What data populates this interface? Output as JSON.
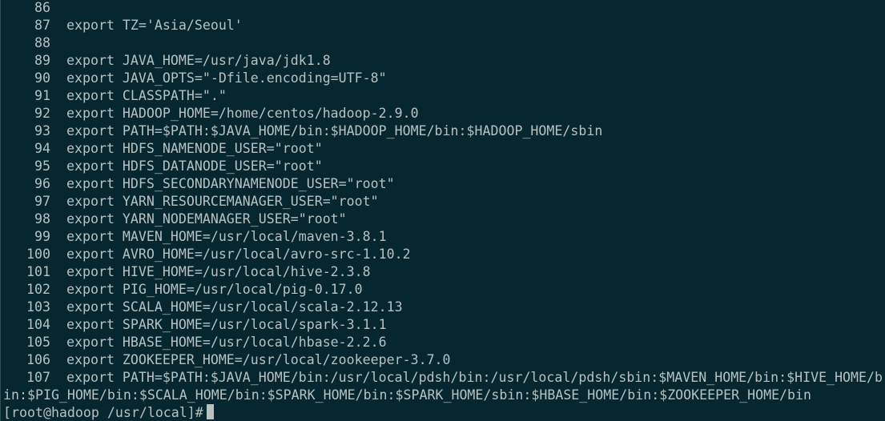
{
  "terminal": {
    "lines": [
      {
        "num": "86",
        "text": ""
      },
      {
        "num": "87",
        "text": "export TZ='Asia/Seoul'"
      },
      {
        "num": "88",
        "text": ""
      },
      {
        "num": "89",
        "text": "export JAVA_HOME=/usr/java/jdk1.8"
      },
      {
        "num": "90",
        "text": "export JAVA_OPTS=\"-Dfile.encoding=UTF-8\""
      },
      {
        "num": "91",
        "text": "export CLASSPATH=\".\""
      },
      {
        "num": "92",
        "text": "export HADOOP_HOME=/home/centos/hadoop-2.9.0"
      },
      {
        "num": "93",
        "text": "export PATH=$PATH:$JAVA_HOME/bin:$HADOOP_HOME/bin:$HADOOP_HOME/sbin"
      },
      {
        "num": "94",
        "text": "export HDFS_NAMENODE_USER=\"root\""
      },
      {
        "num": "95",
        "text": "export HDFS_DATANODE_USER=\"root\""
      },
      {
        "num": "96",
        "text": "export HDFS_SECONDARYNAMENODE_USER=\"root\""
      },
      {
        "num": "97",
        "text": "export YARN_RESOURCEMANAGER_USER=\"root\""
      },
      {
        "num": "98",
        "text": "export YARN_NODEMANAGER_USER=\"root\""
      },
      {
        "num": "99",
        "text": "export MAVEN_HOME=/usr/local/maven-3.8.1"
      },
      {
        "num": "100",
        "text": "export AVRO_HOME=/usr/local/avro-src-1.10.2"
      },
      {
        "num": "101",
        "text": "export HIVE_HOME=/usr/local/hive-2.3.8"
      },
      {
        "num": "102",
        "text": "export PIG_HOME=/usr/local/pig-0.17.0"
      },
      {
        "num": "103",
        "text": "export SCALA_HOME=/usr/local/scala-2.12.13"
      },
      {
        "num": "104",
        "text": "export SPARK_HOME=/usr/local/spark-3.1.1"
      },
      {
        "num": "105",
        "text": "export HBASE_HOME=/usr/local/hbase-2.2.6"
      },
      {
        "num": "106",
        "text": "export ZOOKEEPER_HOME=/usr/local/zookeeper-3.7.0"
      },
      {
        "num": "107",
        "text": "export PATH=$PATH:$JAVA_HOME/bin:/usr/local/pdsh/bin:/usr/local/pdsh/sbin:$MAVEN_HOME/bin:$HIVE_HOME/b"
      }
    ],
    "wrap_text": "in:$PIG_HOME/bin:$SCALA_HOME/bin:$SPARK_HOME/bin:$SPARK_HOME/sbin:$HBASE_HOME/bin:$ZOOKEEPER_HOME/bin",
    "prompt": "[root@hadoop /usr/local]#"
  },
  "colors": {
    "background": "#06272f",
    "foreground": "#b7c1c2"
  }
}
